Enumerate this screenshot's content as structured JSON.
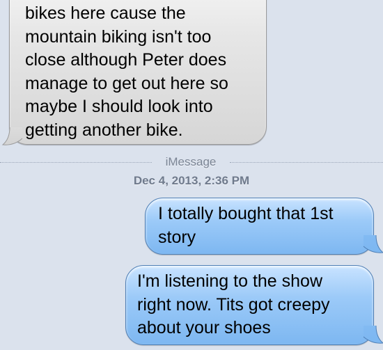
{
  "conversation": {
    "messages": [
      {
        "direction": "incoming",
        "lines": [
          "bikes here cause the",
          "mountain biking isn't too",
          "close although Peter does",
          "manage to get out here so",
          "maybe I should look into",
          "getting another bike."
        ]
      },
      {
        "direction": "outgoing",
        "lines": [
          "I totally bought that 1st",
          "story"
        ]
      },
      {
        "direction": "outgoing",
        "lines": [
          "I'm listening to the show",
          "right now. Tits got creepy",
          "about your shoes"
        ]
      }
    ],
    "divider": {
      "service": "iMessage",
      "timestamp": "Dec 4, 2013, 2:36 PM"
    }
  },
  "colors": {
    "background": "#dbe2ed",
    "incoming_bubble": "#e2e2e2",
    "outgoing_bubble": "#9ccaf8",
    "meta_text": "#7a8494"
  }
}
